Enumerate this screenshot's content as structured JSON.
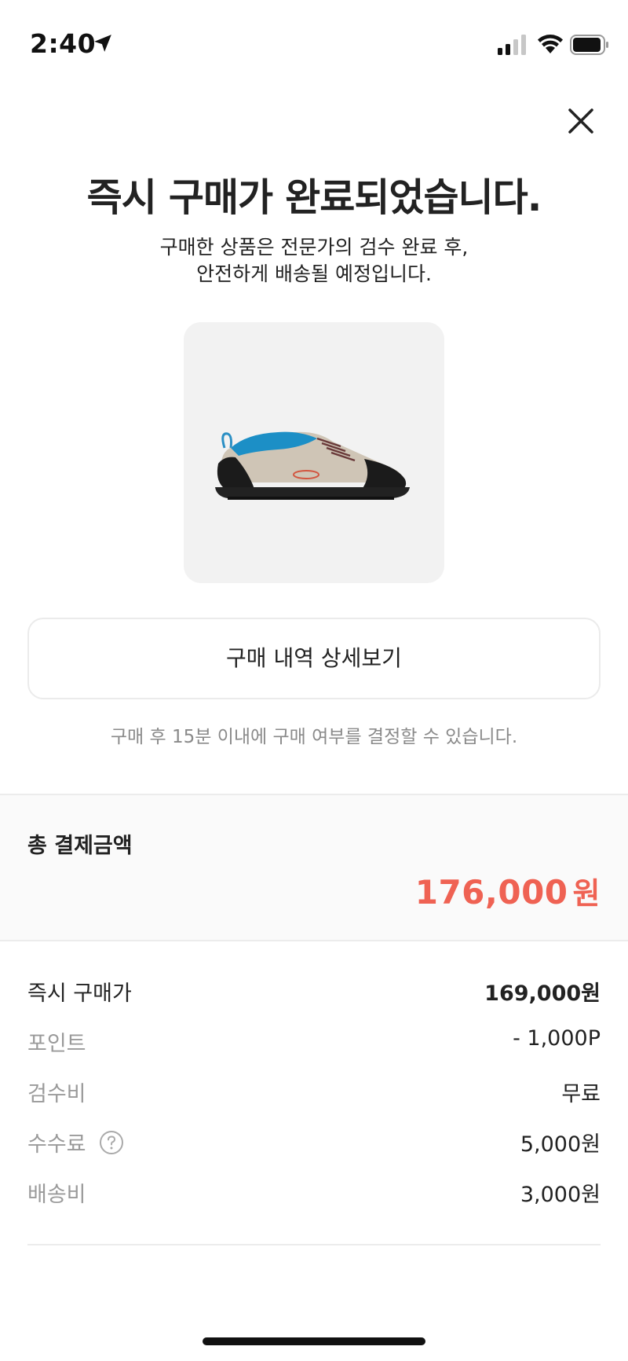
{
  "status_bar": {
    "time": "2:40",
    "icons": [
      "location-arrow-icon",
      "cellular-signal-icon",
      "wifi-icon",
      "battery-icon"
    ]
  },
  "header": {
    "close_icon": "close-icon"
  },
  "main": {
    "title": "즉시 구매가 완료되었습니다.",
    "subtitle_line1": "구매한 상품은 전문가의 검수 완료 후,",
    "subtitle_line2": "안전하게 배송될 예정입니다.",
    "product_image": "shoe-image",
    "detail_button_label": "구매 내역 상세보기",
    "notice": "구매 후 15분 이내에 구매 여부를 결정할 수 있습니다."
  },
  "total": {
    "label": "총 결제금액",
    "amount": "176,000",
    "unit": "원",
    "color": "#ef6253"
  },
  "breakdown": [
    {
      "label": "즉시 구매가",
      "value": "169,000원"
    },
    {
      "label": "포인트",
      "value": "- 1,000P"
    },
    {
      "label": "검수비",
      "value": "무료"
    },
    {
      "label": "수수료",
      "value": "5,000원",
      "icon": "help-circle-icon"
    },
    {
      "label": "배송비",
      "value": "3,000원"
    }
  ]
}
